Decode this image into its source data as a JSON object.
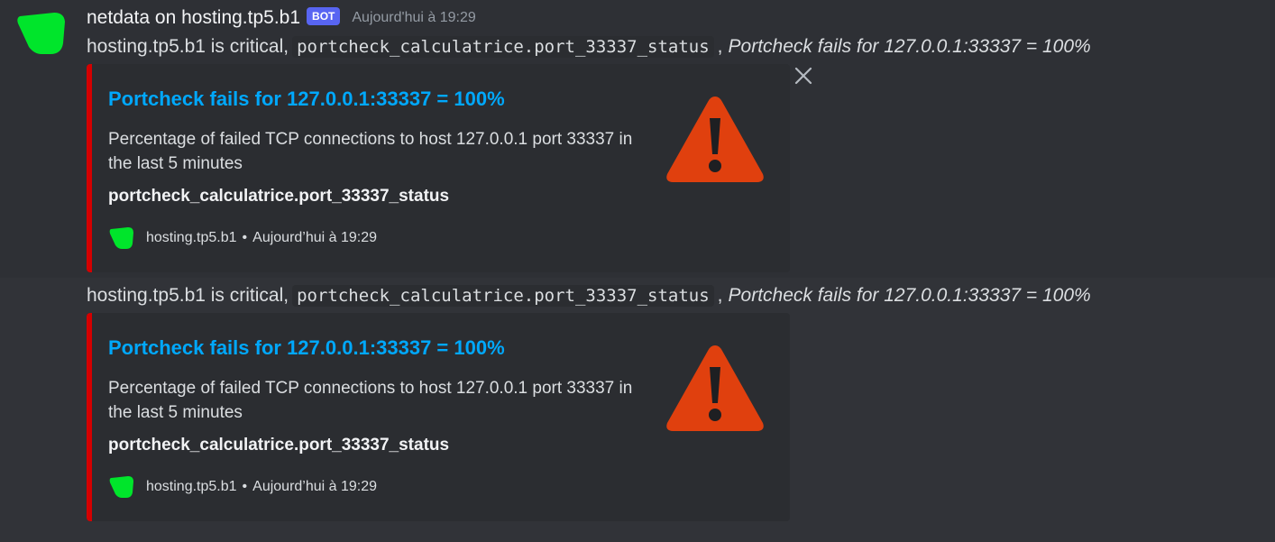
{
  "message": {
    "author": "netdata on hosting.tp5.b1",
    "badge": "BOT",
    "timestamp": "Aujourd'hui à 19:29",
    "avatar_icon": "netdata-green-leaf-icon"
  },
  "posts": [
    {
      "content": {
        "prefix": "hosting.tp5.b1 is critical,",
        "code": "portcheck_calculatrice.port_33337_status",
        "separator": ",",
        "italic": "Portcheck fails for 127.0.0.1:33337 = 100%"
      },
      "embed": {
        "accent_color": "#d40000",
        "title": "Portcheck fails for 127.0.0.1:33337 = 100%",
        "description": "Percentage of failed TCP connections to host 127.0.0.1 port 33337 in the last 5 minutes",
        "field": "portcheck_calculatrice.port_33337_status",
        "footer_text": "hosting.tp5.b1",
        "footer_dot": "•",
        "footer_time": "Aujourd’hui à 19:29",
        "thumbnail_icon": "warning-triangle-icon"
      }
    },
    {
      "content": {
        "prefix": "hosting.tp5.b1 is critical,",
        "code": "portcheck_calculatrice.port_33337_status",
        "separator": ",",
        "italic": "Portcheck fails for 127.0.0.1:33337 = 100%"
      },
      "embed": {
        "accent_color": "#d40000",
        "title": "Portcheck fails for 127.0.0.1:33337 = 100%",
        "description": "Percentage of failed TCP connections to host 127.0.0.1 port 33337 in the last 5 minutes",
        "field": "portcheck_calculatrice.port_33337_status",
        "footer_text": "hosting.tp5.b1",
        "footer_dot": "•",
        "footer_time": "Aujourd’hui à 19:29",
        "thumbnail_icon": "warning-triangle-icon"
      }
    }
  ]
}
